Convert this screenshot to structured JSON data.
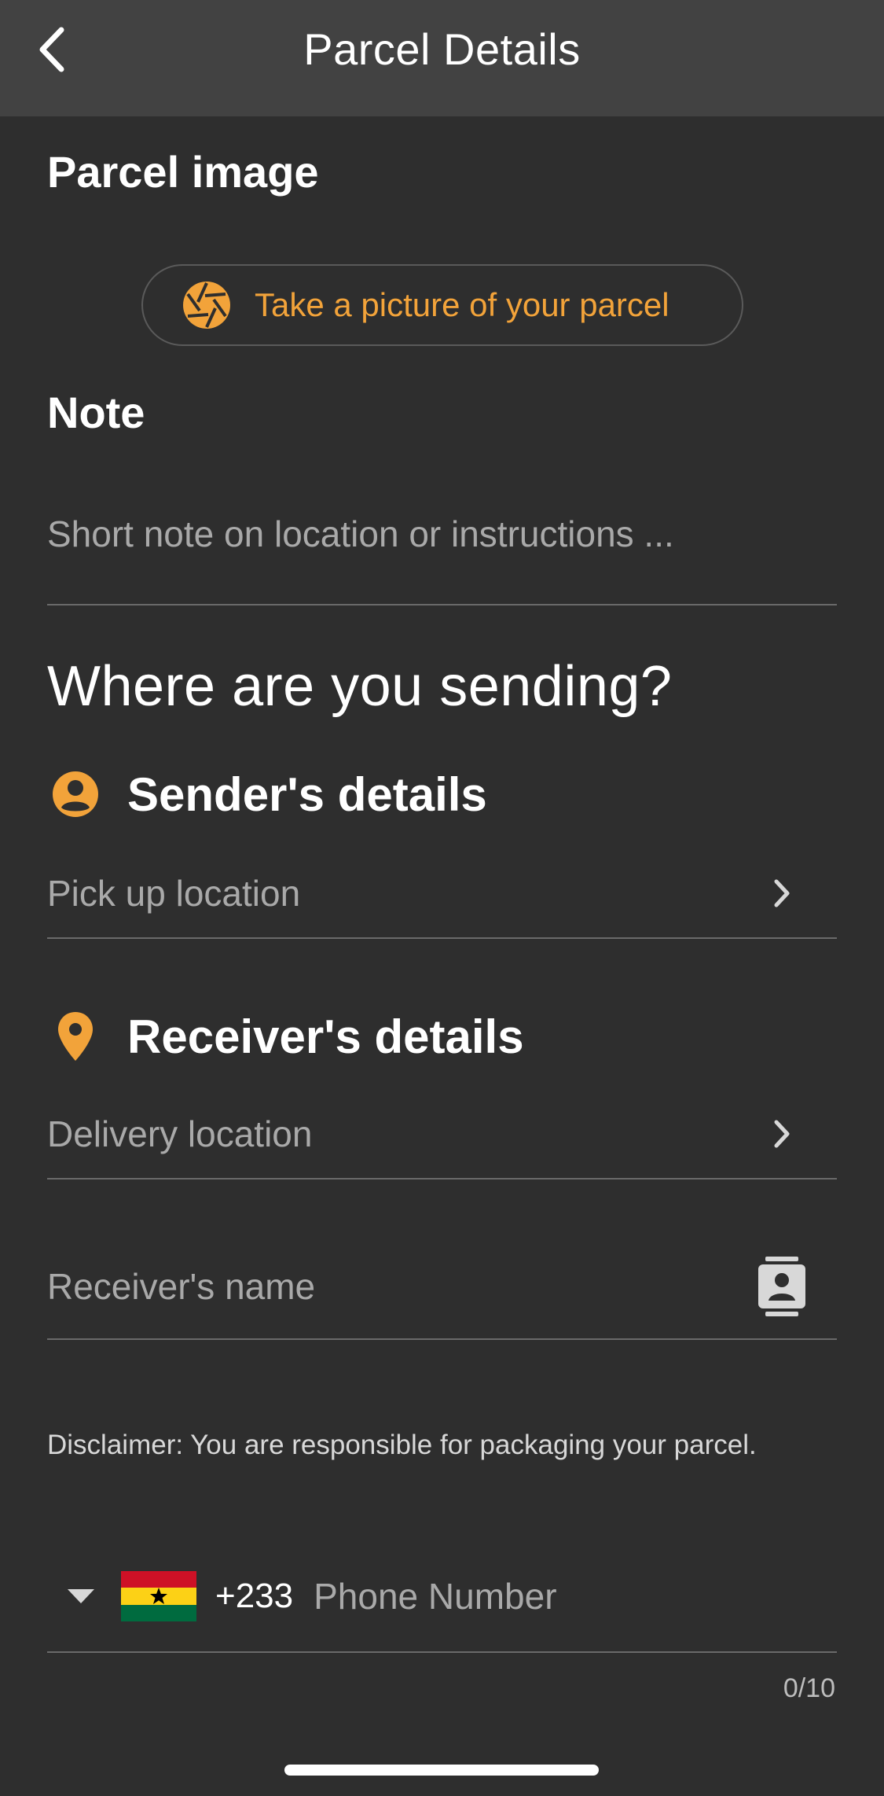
{
  "header": {
    "title": "Parcel Details"
  },
  "parcel_image": {
    "title": "Parcel image",
    "take_picture_label": "Take a picture of your parcel"
  },
  "note": {
    "title": "Note",
    "placeholder": "Short note on location or instructions ..."
  },
  "sending": {
    "heading": "Where are you sending?"
  },
  "sender": {
    "title": "Sender's details",
    "field_placeholder": "Pick up location"
  },
  "receiver": {
    "title": "Receiver's details",
    "location_placeholder": "Delivery location",
    "name_placeholder": "Receiver's name"
  },
  "disclaimer": "Disclaimer: You are responsible for packaging your parcel.",
  "phone": {
    "country_code": "+233",
    "placeholder": "Phone Number",
    "counter": "0/10"
  },
  "colors": {
    "accent": "#f2a33a",
    "background": "#2e2e2e",
    "header": "#424242"
  },
  "icons": {
    "back": "chevron-left-icon",
    "camera": "camera-aperture-icon",
    "sender": "person-circle-icon",
    "receiver": "location-pin-icon",
    "contacts": "contact-card-icon",
    "chevron": "chevron-right-icon",
    "dropdown": "triangle-down-icon",
    "flag": "ghana-flag-icon"
  }
}
